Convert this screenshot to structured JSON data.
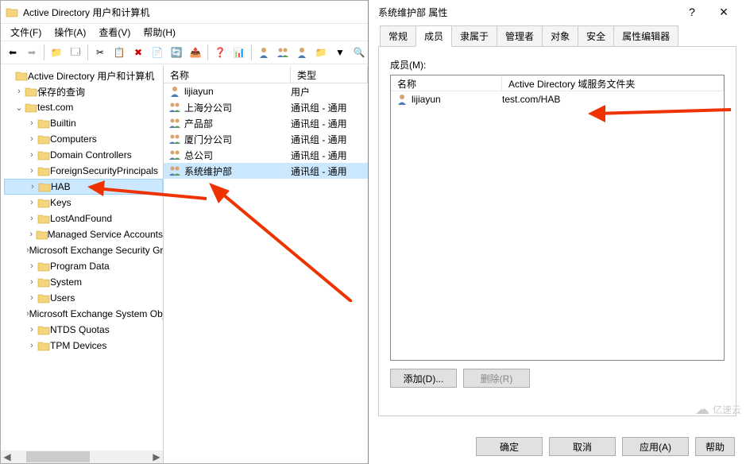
{
  "mainWindow": {
    "title": "Active Directory 用户和计算机",
    "menus": [
      "文件(F)",
      "操作(A)",
      "查看(V)",
      "帮助(H)"
    ]
  },
  "tree": {
    "root": "Active Directory 用户和计算机",
    "savedQueries": "保存的查询",
    "domain": "test.com",
    "nodes": [
      {
        "label": "Builtin"
      },
      {
        "label": "Computers"
      },
      {
        "label": "Domain Controllers"
      },
      {
        "label": "ForeignSecurityPrincipals"
      },
      {
        "label": "HAB",
        "selected": true
      },
      {
        "label": "Keys"
      },
      {
        "label": "LostAndFound"
      },
      {
        "label": "Managed Service Accounts"
      },
      {
        "label": "Microsoft Exchange Security Groups"
      },
      {
        "label": "Program Data"
      },
      {
        "label": "System"
      },
      {
        "label": "Users"
      },
      {
        "label": "Microsoft Exchange System Objects"
      },
      {
        "label": "NTDS Quotas"
      },
      {
        "label": "TPM Devices"
      }
    ]
  },
  "list": {
    "headers": {
      "name": "名称",
      "type": "类型"
    },
    "rows": [
      {
        "icon": "user",
        "name": "lijiayun",
        "type": "用户"
      },
      {
        "icon": "group",
        "name": "上海分公司",
        "type": "通讯组 - 通用"
      },
      {
        "icon": "group",
        "name": "产品部",
        "type": "通讯组 - 通用"
      },
      {
        "icon": "group",
        "name": "厦门分公司",
        "type": "通讯组 - 通用"
      },
      {
        "icon": "group",
        "name": "总公司",
        "type": "通讯组 - 通用"
      },
      {
        "icon": "group",
        "name": "系统维护部",
        "type": "通讯组 - 通用",
        "selected": true
      }
    ]
  },
  "dialog": {
    "title": "系统维护部 属性",
    "help": "?",
    "close": "×",
    "tabs": [
      "常规",
      "成员",
      "隶属于",
      "管理者",
      "对象",
      "安全",
      "属性编辑器"
    ],
    "activeTab": 1,
    "membersLabel": "成员(M):",
    "memberHeaders": {
      "name": "名称",
      "folder": "Active Directory 域服务文件夹"
    },
    "memberRows": [
      {
        "icon": "user",
        "name": "lijiayun",
        "folder": "test.com/HAB"
      }
    ],
    "addBtn": "添加(D)...",
    "removeBtn": "删除(R)",
    "okBtn": "确定",
    "cancelBtn": "取消",
    "applyBtn": "应用(A)",
    "helpBtn": "帮助"
  },
  "watermark": "亿速云"
}
